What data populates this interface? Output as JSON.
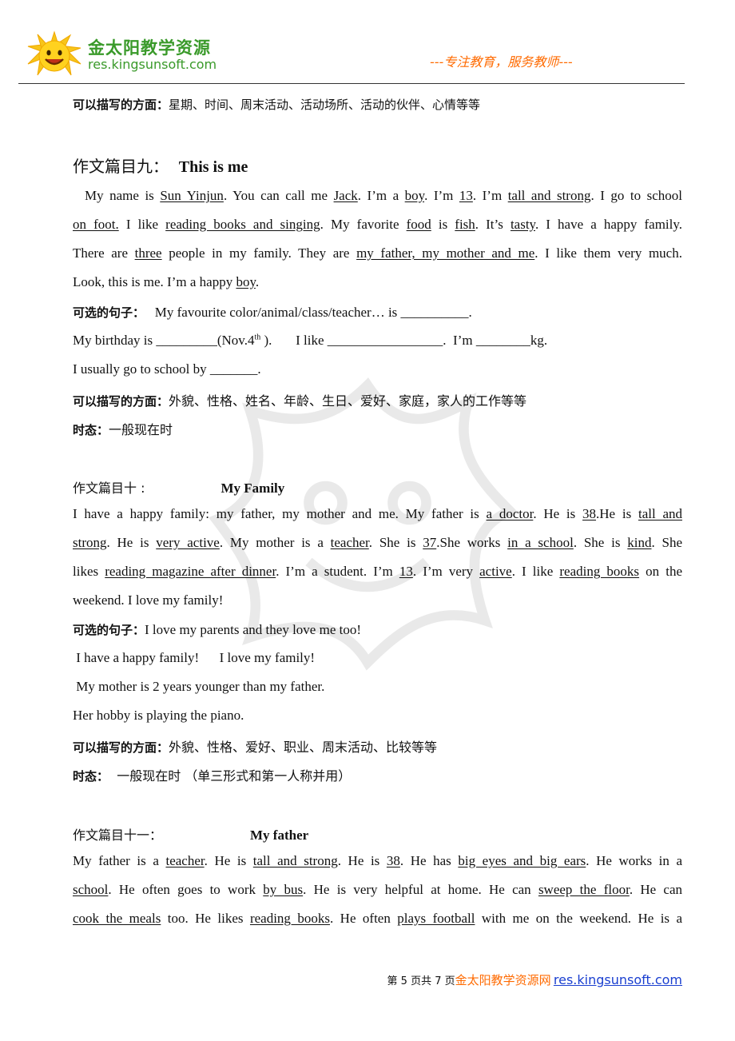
{
  "header": {
    "logo_cn": "金太阳教学资源",
    "logo_url": "res.kingsunsoft.com",
    "slogan": "---专注教育，服务教师---"
  },
  "top_note": {
    "label": "可以描写的方面：",
    "text": "星期、时间、周末活动、活动场所、活动的伙伴、心情等等"
  },
  "essay9": {
    "heading_cn": "作文篇目九：",
    "heading_en": "This is me",
    "lines": [
      [
        "  My name is ",
        {
          "u": "Sun Yinjun"
        },
        ". You can call me ",
        {
          "u": "Jack"
        },
        ". I’m a ",
        {
          "u": "boy"
        },
        ". I’m ",
        {
          "u": "13"
        },
        ". I’m ",
        {
          "u": "tall and strong"
        },
        ". I go to school"
      ],
      [
        {
          "u": "on foot."
        },
        " I like ",
        {
          "u": "reading books and singing"
        },
        ". My favorite ",
        {
          "u": "food"
        },
        " is ",
        {
          "u": "fish"
        },
        ". It’s ",
        {
          "u": "tasty"
        },
        ". I have a happy family."
      ],
      [
        "There are ",
        {
          "u": "three"
        },
        " people in my family. They are ",
        {
          "u": "my father, my mother and me"
        },
        ". I like them very much."
      ],
      [
        "Look, this is me. I’m a happy ",
        {
          "u": "boy"
        },
        "."
      ]
    ],
    "optional_label": "可选的句子：",
    "optional_1": "My favourite color/animal/class/teacher… is __________.",
    "optional_2a": "My birthday is _________(Nov.4",
    "optional_2_sup": "th",
    "optional_2b": " ).       I like _________________.  I’m ________kg.",
    "optional_3": "I usually go to school by _______.",
    "aspects_label": "可以描写的方面：",
    "aspects": "外貌、性格、姓名、年龄、生日、爱好、家庭，家人的工作等等",
    "tense_label": "时态：",
    "tense": "一般现在时"
  },
  "essay10": {
    "heading_cn": "作文篇目十 :",
    "heading_en": "My Family",
    "lines": [
      [
        "I have a happy family: my father, my mother and me. My father is ",
        {
          "u": "a doctor"
        },
        ". He is ",
        {
          "u": "38"
        },
        ".He is ",
        {
          "u": "tall and"
        }
      ],
      [
        {
          "u": "strong"
        },
        ". He is ",
        {
          "u": "very active"
        },
        ". My mother is a ",
        {
          "u": "teacher"
        },
        ". She is ",
        {
          "u": "37"
        },
        ".She works ",
        {
          "u": "in a school"
        },
        ". She is ",
        {
          "u": "kind"
        },
        ". She"
      ],
      [
        "likes ",
        {
          "u": "reading magazine after dinner"
        },
        ". I’m a student. I’m ",
        {
          "u": "13"
        },
        ". I’m very ",
        {
          "u": "active"
        },
        ". I like ",
        {
          "u": "reading books"
        },
        " on the"
      ],
      [
        "weekend. I love my family!"
      ]
    ],
    "optional_label": "可选的句子：",
    "optional_1": "I love my parents and they love me too!",
    "optional_2": " I have a happy family!      I love my family!",
    "optional_3": " My mother is 2 years younger than my father.",
    "optional_4": "Her hobby is playing the piano.",
    "aspects_label": "可以描写的方面：",
    "aspects": "外貌、性格、爱好、职业、周末活动、比较等等",
    "tense_label": "时态：",
    "tense": "  一般现在时 （单三形式和第一人称并用）"
  },
  "essay11": {
    "heading_cn": "作文篇目十一：",
    "heading_en": "My father",
    "lines": [
      [
        "My father is a ",
        {
          "u": "teacher"
        },
        ". He is ",
        {
          "u": "tall and strong"
        },
        ". He is ",
        {
          "u": "38"
        },
        ". He has ",
        {
          "u": "big eyes and big ears"
        },
        ". He works in a"
      ],
      [
        {
          "u": "school"
        },
        ". He often goes to work ",
        {
          "u": "by bus"
        },
        ". He is very helpful at home. He can ",
        {
          "u": "sweep the floor"
        },
        ". He can"
      ],
      [
        {
          "u": "cook the meals"
        },
        " too. He likes ",
        {
          "u": "reading books"
        },
        ". He often ",
        {
          "u": "plays football"
        },
        " with me on the weekend. He is a"
      ]
    ]
  },
  "footer": {
    "page_text": "第 5 页共 7 页",
    "org": "金太阳教学资源网",
    "url": "res.kingsunsoft.com"
  },
  "colors": {
    "brand_green": "#3a9a2a",
    "slogan_orange": "#ff6a00",
    "link_blue": "#1a3fd0"
  }
}
